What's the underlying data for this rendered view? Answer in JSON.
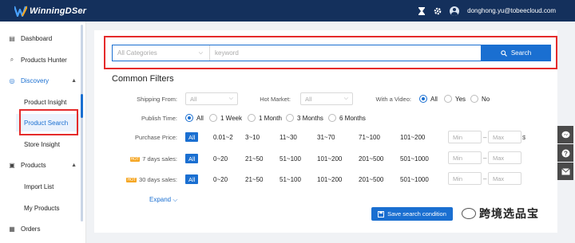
{
  "app": {
    "name": "WinningDSer",
    "user_email": "donghong.yu@tobeecloud.com"
  },
  "icons": {
    "logo": "winningdser-logo-icon",
    "hourglass": "hourglass-icon",
    "settings": "gear-icon",
    "user": "user-avatar-icon"
  },
  "colors": {
    "topbar": "#14305c",
    "accent": "#1a6fd1",
    "highlight_box": "#e52b2b"
  },
  "sidebar": {
    "dashboard": "Dashboard",
    "products_hunter": "Products Hunter",
    "discovery": "Discovery",
    "product_insight": "Product Insight",
    "product_search": "Product Search",
    "store_insight": "Store Insight",
    "products": "Products",
    "import_list": "Import List",
    "my_products": "My Products",
    "orders": "Orders"
  },
  "search": {
    "category_placeholder": "All Categories",
    "keyword_placeholder": "keyword",
    "button_label": "Search"
  },
  "filters": {
    "title": "Common Filters",
    "shipping_from": {
      "label": "Shipping From:",
      "value": "All"
    },
    "hot_market": {
      "label": "Hot Market:",
      "value": "All"
    },
    "with_video": {
      "label": "With a Video:",
      "options": [
        "All",
        "Yes",
        "No"
      ],
      "selected": "All"
    },
    "publish_time": {
      "label": "Publish Time:",
      "options": [
        "All",
        "1 Week",
        "1 Month",
        "3 Months",
        "6 Months"
      ],
      "selected": "All"
    },
    "purchase_price": {
      "label": "Purchase Price:",
      "options": [
        "All",
        "0.01~2",
        "3~10",
        "11~30",
        "31~70",
        "71~100",
        "101~200"
      ],
      "min": "Min",
      "max": "Max",
      "currency": "$"
    },
    "sales_7": {
      "label": "7 days sales:",
      "options": [
        "All",
        "0~20",
        "21~50",
        "51~100",
        "101~200",
        "201~500",
        "501~1000"
      ],
      "min": "Min",
      "max": "Max"
    },
    "sales_30": {
      "label": "30 days sales:",
      "options": [
        "All",
        "0~20",
        "21~50",
        "51~100",
        "101~200",
        "201~500",
        "501~1000"
      ],
      "min": "Min",
      "max": "Max"
    },
    "expand_label": "Expand",
    "save_label": "Save search condition"
  },
  "watermark": "跨境选品宝"
}
